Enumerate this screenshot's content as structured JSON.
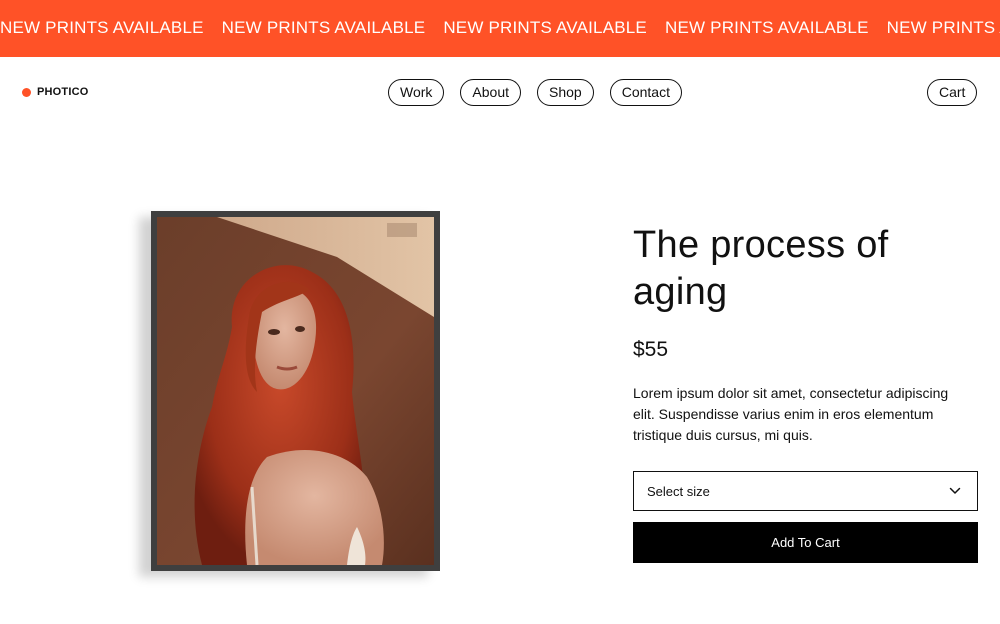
{
  "announcement": {
    "items": [
      "NEW PRINTS AVAILABLE",
      "NEW PRINTS AVAILABLE",
      "NEW PRINTS AVAILABLE",
      "NEW PRINTS AVAILABLE",
      "NEW PRINTS AVAILABLE"
    ],
    "background": "#ff5227"
  },
  "header": {
    "brand": "PHOTICO",
    "brand_dot_color": "#ff5227",
    "nav": [
      "Work",
      "About",
      "Shop",
      "Contact"
    ],
    "cart_label": "Cart"
  },
  "product": {
    "title": "The process of aging",
    "price": "$55",
    "description": "Lorem ipsum dolor sit amet, consectetur adipiscing elit. Suspendisse varius enim in eros elementum tristique duis cursus, mi quis.",
    "size_select": {
      "selected": "Select size"
    },
    "add_to_cart_label": "Add To Cart",
    "image_icon": "portrait-photo"
  }
}
